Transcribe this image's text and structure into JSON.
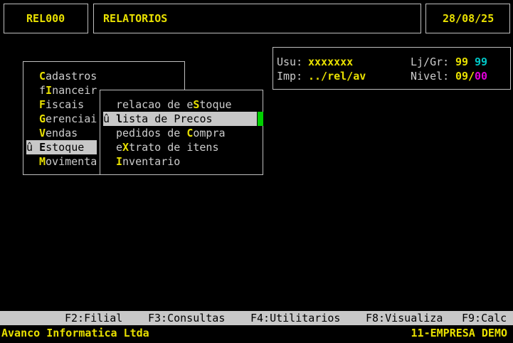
{
  "header": {
    "program_code": "REL000",
    "title": "RELATORIOS",
    "date": "28/08/25"
  },
  "info_panel": {
    "user_label": "Usu:",
    "user_value": "xxxxxxx",
    "store_label": "Lj/Gr:",
    "store_value": "99",
    "group_value": "99",
    "printer_label": "Imp:",
    "printer_value": "../rel/av",
    "level_label": "Nivel:",
    "level_value": "09",
    "level_separator": "/",
    "level_sub_value": "00"
  },
  "main_menu": {
    "items": [
      {
        "pre": "",
        "hot": "C",
        "post": "adastros"
      },
      {
        "pre": "f",
        "hot": "I",
        "post": "nanceir"
      },
      {
        "pre": "",
        "hot": "F",
        "post": "iscais"
      },
      {
        "pre": "",
        "hot": "G",
        "post": "erenciai"
      },
      {
        "pre": "",
        "hot": "V",
        "post": "endas"
      },
      {
        "pre": "û ",
        "hot": "E",
        "post": "stoque"
      },
      {
        "pre": "",
        "hot": "M",
        "post": "ovimenta"
      }
    ]
  },
  "submenu": {
    "items": [
      {
        "pre": "relacao de e",
        "hot": "S",
        "post": "toque"
      },
      {
        "pre": "û ",
        "hot": "l",
        "post": "ista de Precos"
      },
      {
        "pre": "pedidos de ",
        "hot": "C",
        "post": "ompra"
      },
      {
        "pre": "e",
        "hot": "X",
        "post": "trato de itens"
      },
      {
        "pre": "",
        "hot": "I",
        "post": "nventario"
      }
    ]
  },
  "function_keys": [
    "F2:Filial",
    "F3:Consultas",
    "F4:Utilitarios",
    "F8:Visualiza",
    "F9:Calc"
  ],
  "footer": {
    "company_left": "Avanco Informatica Ltda",
    "company_right": "11-EMPRESA DEMO"
  },
  "colors": {
    "highlight": "#e8e000",
    "cyan": "#00c8c8",
    "magenta": "#e000d8",
    "selection": "#c8c8c8",
    "cursor": "#00d000"
  }
}
